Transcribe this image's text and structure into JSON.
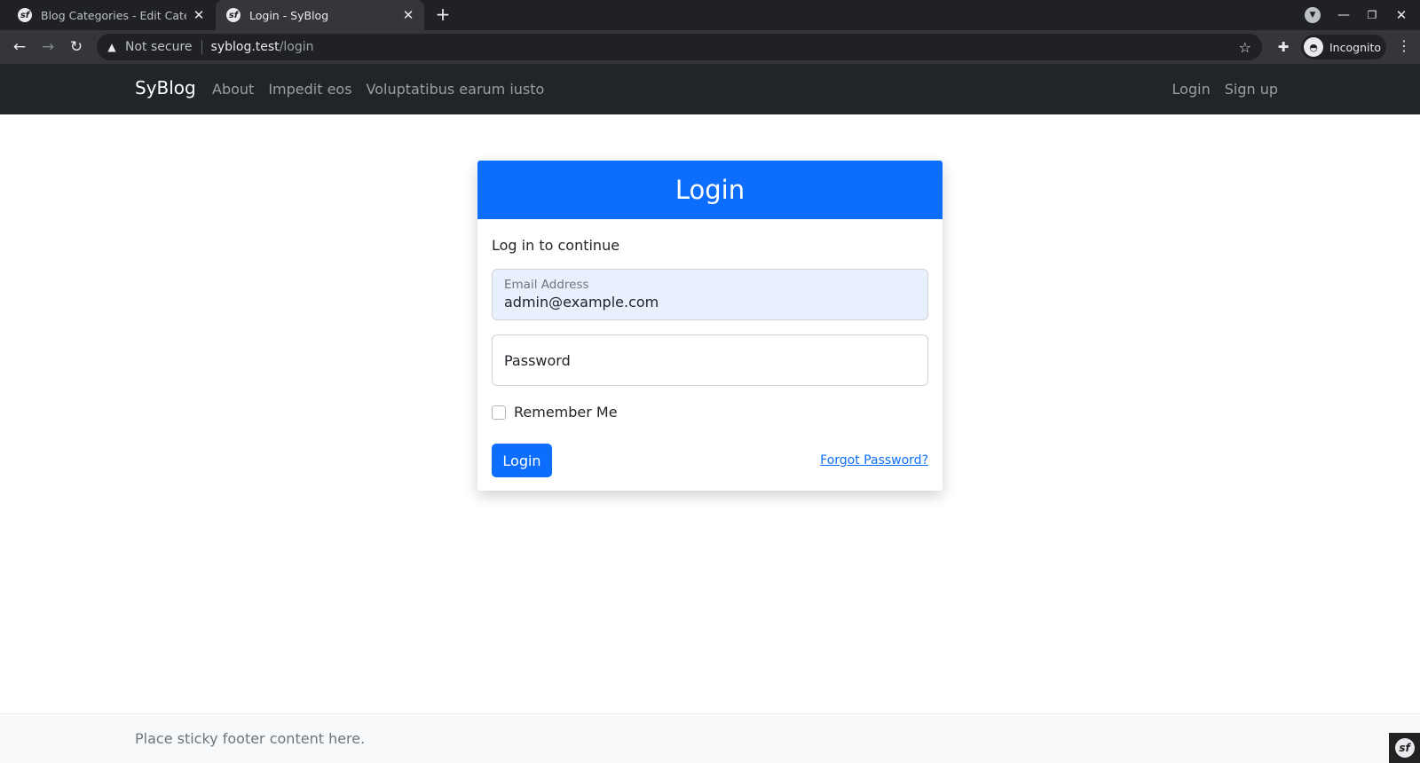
{
  "browser": {
    "tabs": [
      {
        "title": "Blog Categories - Edit Category",
        "favicon": "symfony-icon",
        "active": false
      },
      {
        "title": "Login - SyBlog",
        "favicon": "symfony-icon",
        "active": true
      }
    ],
    "address": {
      "security_label": "Not secure",
      "host": "syblog.test",
      "path": "/login"
    },
    "profile_label": "Incognito"
  },
  "navbar": {
    "brand": "SyBlog",
    "links": [
      "About",
      "Impedit eos",
      "Voluptatibus earum iusto"
    ],
    "right_links": [
      "Login",
      "Sign up"
    ]
  },
  "login_card": {
    "header": "Login",
    "subtitle": "Log in to continue",
    "email": {
      "label": "Email Address",
      "value": "admin@example.com"
    },
    "password": {
      "placeholder": "Password",
      "value": ""
    },
    "remember_label": "Remember Me",
    "remember_checked": false,
    "submit_label": "Login",
    "forgot_label": "Forgot Password?"
  },
  "footer": {
    "text": "Place sticky footer content here."
  },
  "colors": {
    "primary": "#0d6efd",
    "navbar_bg": "#212529",
    "autofill_bg": "#e8f0fe"
  }
}
